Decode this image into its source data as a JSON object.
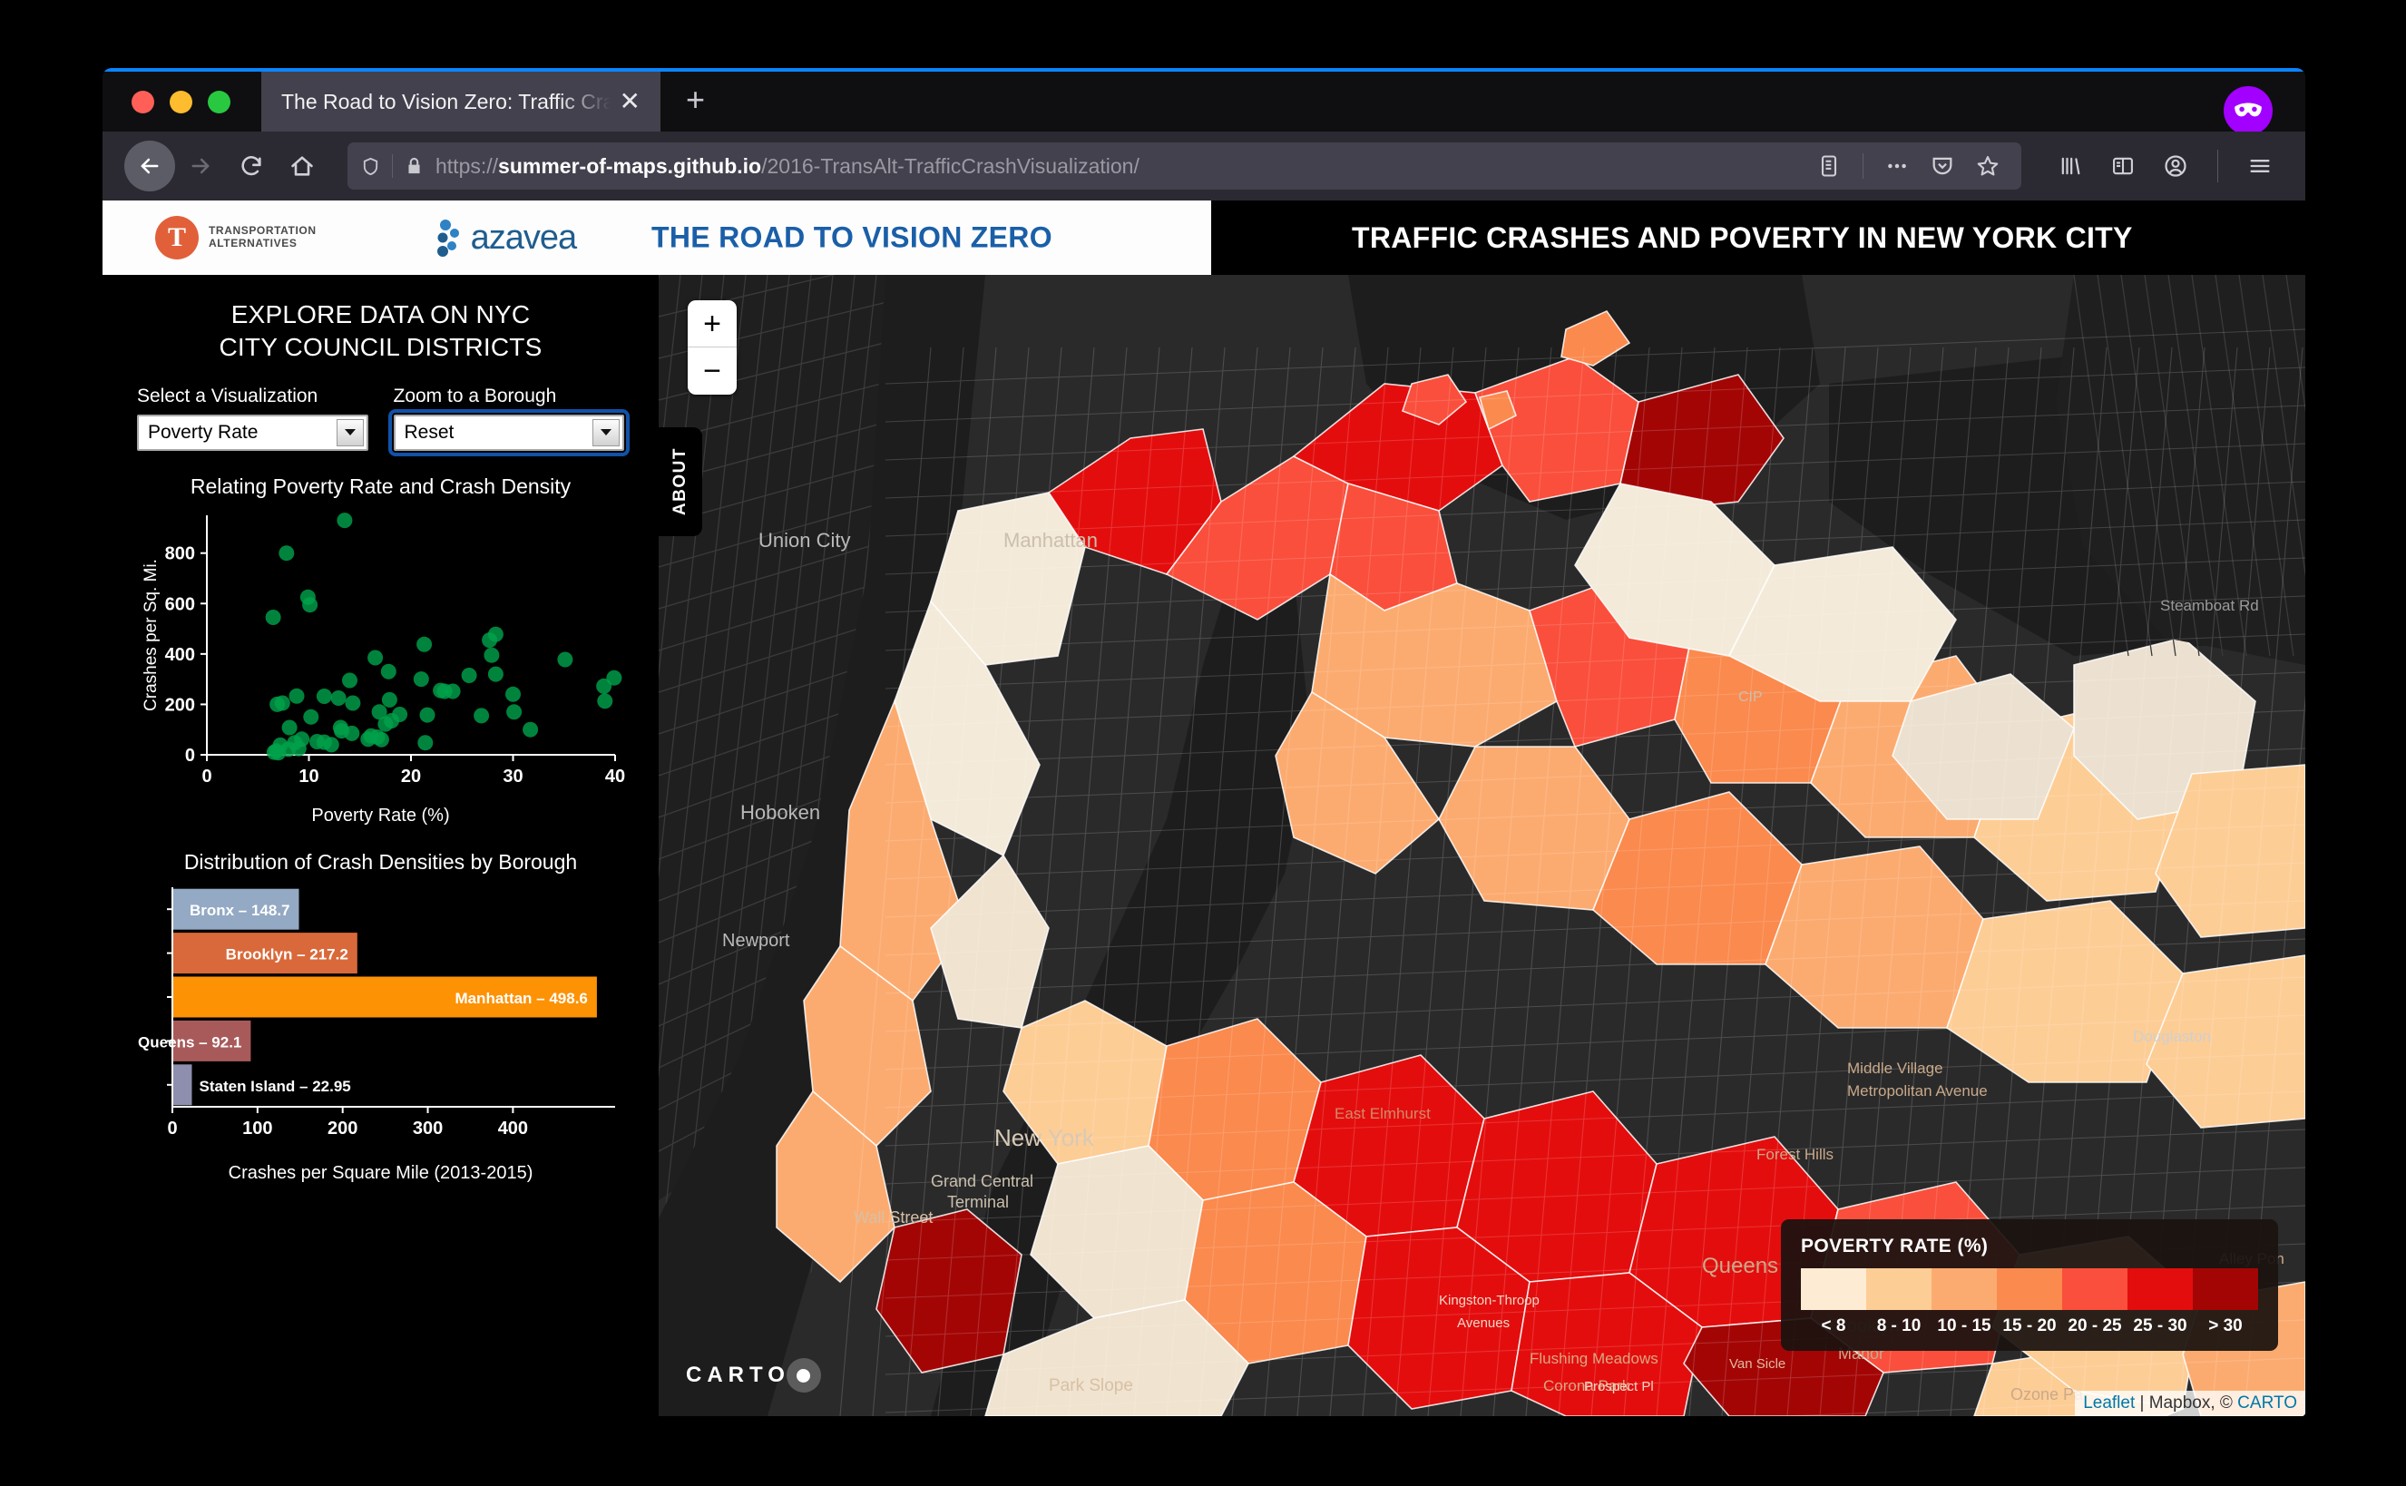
{
  "browser": {
    "tab_title": "The Road to Vision Zero: Traffic Cra",
    "tab_close_label": "✕",
    "new_tab_label": "+",
    "url_scheme": "https://",
    "url_host": "summer-of-maps.github.io",
    "url_path": "/2016-TransAlt-TrafficCrashVisualization/",
    "url_full": "https://summer-of-maps.github.io/2016-TransAlt-TrafficCrashVisualization/"
  },
  "header": {
    "org1_name_line1": "TRANSPORTATION",
    "org1_name_line2": "ALTERNATIVES",
    "org1_mark": "T",
    "org2_name": "azavea",
    "title_left": "THE ROAD TO VISION ZERO",
    "title_right": "TRAFFIC CRASHES AND POVERTY IN NEW YORK CITY"
  },
  "sidebar": {
    "heading_line1": "EXPLORE DATA ON NYC",
    "heading_line2": "CITY COUNCIL DISTRICTS",
    "visualization_label": "Select a Visualization",
    "visualization_value": "Poverty Rate",
    "borough_label": "Zoom to a Borough",
    "borough_value": "Reset"
  },
  "map": {
    "zoom_in_label": "+",
    "zoom_out_label": "−",
    "about_tab_label": "ABOUT",
    "carto_label": "CARTO",
    "attribution_leaflet": "Leaflet",
    "attribution_separator": " | ",
    "attribution_mapbox": "Mapbox, © ",
    "attribution_carto": "CARTO"
  },
  "legend": {
    "title": "POVERTY RATE (%)",
    "bins": [
      {
        "label": "< 8",
        "color": "#fdebd4"
      },
      {
        "label": "8 - 10",
        "color": "#fdcd96"
      },
      {
        "label": "10 - 15",
        "color": "#fcab70"
      },
      {
        "label": "15 - 20",
        "color": "#fb8a4e"
      },
      {
        "label": "20 - 25",
        "color": "#fa4f3c"
      },
      {
        "label": "25 - 30",
        "color": "#e40d0d"
      },
      {
        "label": "> 30",
        "color": "#a30505"
      }
    ]
  },
  "chart_data": [
    {
      "type": "scatter",
      "title": "Relating Poverty Rate and Crash Density",
      "xlabel": "Poverty Rate (%)",
      "ylabel": "Crashes per Sq. Mi.",
      "xlim": [
        0,
        40
      ],
      "ylim": [
        0,
        950
      ],
      "xticks": [
        0,
        10,
        20,
        30,
        40
      ],
      "yticks": [
        0,
        200,
        400,
        600,
        800
      ],
      "grid": false,
      "point_color": "#00a14b",
      "points": [
        [
          13.5,
          930
        ],
        [
          7.8,
          800
        ],
        [
          9.9,
          625
        ],
        [
          10.1,
          595
        ],
        [
          6.5,
          545
        ],
        [
          28.3,
          478
        ],
        [
          27.7,
          455
        ],
        [
          21.3,
          438
        ],
        [
          27.9,
          395
        ],
        [
          16.5,
          385
        ],
        [
          35.1,
          378
        ],
        [
          17.8,
          330
        ],
        [
          28.3,
          320
        ],
        [
          25.7,
          315
        ],
        [
          14.0,
          295
        ],
        [
          21.0,
          300
        ],
        [
          39.9,
          305
        ],
        [
          38.9,
          272
        ],
        [
          22.9,
          255
        ],
        [
          24.1,
          252
        ],
        [
          30.0,
          240
        ],
        [
          8.8,
          233
        ],
        [
          11.5,
          232
        ],
        [
          7.4,
          205
        ],
        [
          12.9,
          225
        ],
        [
          17.9,
          218
        ],
        [
          14.3,
          205
        ],
        [
          6.9,
          200
        ],
        [
          39.0,
          213
        ],
        [
          10.2,
          150
        ],
        [
          30.1,
          170
        ],
        [
          26.9,
          155
        ],
        [
          18.9,
          160
        ],
        [
          21.6,
          158
        ],
        [
          16.9,
          170
        ],
        [
          17.5,
          122
        ],
        [
          13.1,
          108
        ],
        [
          8.1,
          108
        ],
        [
          31.7,
          100
        ],
        [
          13.2,
          95
        ],
        [
          14.2,
          85
        ],
        [
          16.1,
          75
        ],
        [
          16.7,
          70
        ],
        [
          17.1,
          60
        ],
        [
          9.3,
          62
        ],
        [
          10.8,
          52
        ],
        [
          11.5,
          50
        ],
        [
          21.4,
          48
        ],
        [
          7.2,
          38
        ],
        [
          8.6,
          48
        ],
        [
          8.0,
          22
        ],
        [
          9.0,
          25
        ],
        [
          6.8,
          15
        ],
        [
          7.0,
          8
        ],
        [
          6.6,
          10
        ],
        [
          15.8,
          62
        ],
        [
          12.2,
          40
        ],
        [
          18.1,
          135
        ],
        [
          23.3,
          252
        ]
      ]
    },
    {
      "type": "bar",
      "orientation": "horizontal",
      "title": "Distribution of Crash Densities by Borough",
      "xlabel": "Crashes per Square Mile (2013-2015)",
      "ylabel": "",
      "xlim": [
        0,
        520
      ],
      "xticks": [
        0,
        100,
        200,
        300,
        400
      ],
      "grid": false,
      "categories": [
        "Bronx",
        "Brooklyn",
        "Manhattan",
        "Queens",
        "Staten Island"
      ],
      "values": [
        148.7,
        217.2,
        498.6,
        92.1,
        22.95
      ],
      "bar_labels": [
        "Bronx – 148.7",
        "Brooklyn – 217.2",
        "Manhattan – 498.6",
        "Queens – 92.1",
        "Staten Island – 22.95"
      ],
      "colors": [
        "#93a9c4",
        "#d9693a",
        "#fd9205",
        "#a85a5a",
        "#8e8fae"
      ],
      "label_inside": [
        true,
        true,
        true,
        true,
        false
      ]
    }
  ]
}
